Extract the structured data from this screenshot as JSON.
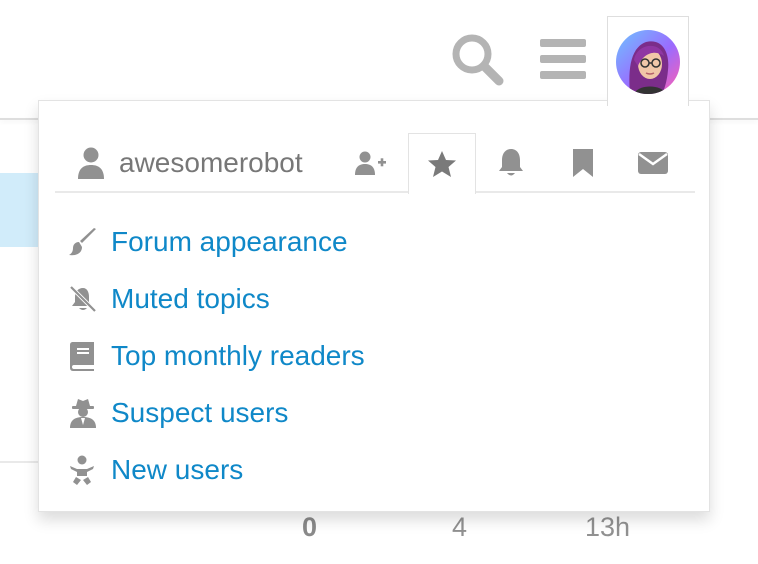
{
  "header": {
    "search_icon": "search-icon",
    "menu_icon": "hamburger-icon",
    "avatar": "user-avatar"
  },
  "user_menu": {
    "username": "awesomerobot",
    "tabs": [
      "user-profile",
      "invite",
      "favorites",
      "notifications",
      "bookmarks",
      "messages"
    ],
    "active_tab": "favorites",
    "items": [
      {
        "label": "Forum appearance",
        "icon": "paintbrush-icon"
      },
      {
        "label": "Muted topics",
        "icon": "bell-slash-icon"
      },
      {
        "label": "Top monthly readers",
        "icon": "book-icon"
      },
      {
        "label": "Suspect users",
        "icon": "user-secret-icon"
      },
      {
        "label": "New users",
        "icon": "baby-icon"
      }
    ]
  },
  "topic_row": {
    "replies": "0",
    "views": "4",
    "activity": "13h"
  },
  "colors": {
    "link": "#0f88c8",
    "icon_gray": "#919191",
    "highlight": "#d1ecfa"
  }
}
